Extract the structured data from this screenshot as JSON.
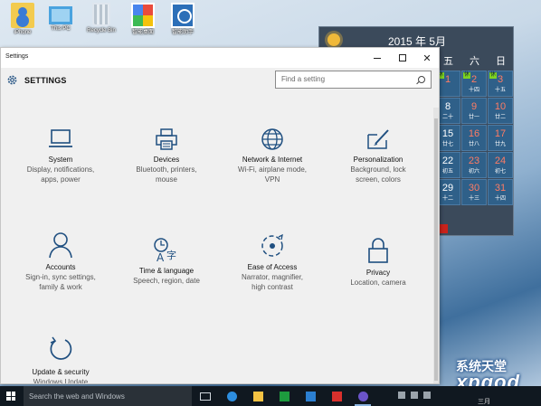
{
  "desktop": {
    "icons": [
      {
        "label": "iPhone",
        "icon": "user-folder-icon"
      },
      {
        "label": "This PC",
        "icon": "computer-icon"
      },
      {
        "label": "Recycle Bin",
        "icon": "recycle-bin-icon"
      },
      {
        "label": "智能桌面",
        "icon": "app-shortcut-icon"
      },
      {
        "label": "智能助手",
        "icon": "app-shortcut-icon"
      }
    ]
  },
  "calendar": {
    "month_label": "2015 年 5月",
    "weekdays": [
      "五",
      "六",
      "日"
    ],
    "rows": [
      [
        {
          "d": "1",
          "l": "",
          "badge": "休",
          "red": true
        },
        {
          "d": "2",
          "l": "十四",
          "badge": "休",
          "red": true
        },
        {
          "d": "3",
          "l": "十五",
          "badge": "休",
          "red": true
        }
      ],
      [
        {
          "d": "8",
          "l": "二十",
          "red": false
        },
        {
          "d": "9",
          "l": "廿一",
          "red": true
        },
        {
          "d": "10",
          "l": "廿二",
          "red": true
        }
      ],
      [
        {
          "d": "15",
          "l": "廿七",
          "red": false
        },
        {
          "d": "16",
          "l": "廿八",
          "red": true
        },
        {
          "d": "17",
          "l": "廿九",
          "red": true
        }
      ],
      [
        {
          "d": "22",
          "l": "初五",
          "red": false
        },
        {
          "d": "23",
          "l": "初六",
          "red": true
        },
        {
          "d": "24",
          "l": "初七",
          "red": true
        }
      ],
      [
        {
          "d": "29",
          "l": "十二",
          "red": false
        },
        {
          "d": "30",
          "l": "十三",
          "red": true
        },
        {
          "d": "31",
          "l": "十四",
          "red": true
        }
      ]
    ]
  },
  "window": {
    "title": "Settings",
    "heading": "SETTINGS",
    "search_placeholder": "Find a setting",
    "tiles": [
      {
        "name": "System",
        "desc1": "Display, notifications,",
        "desc2": "apps, power",
        "icon": "laptop-icon"
      },
      {
        "name": "Devices",
        "desc1": "Bluetooth, printers,",
        "desc2": "mouse",
        "icon": "printer-icon"
      },
      {
        "name": "Network & Internet",
        "desc1": "Wi-Fi, airplane mode,",
        "desc2": "VPN",
        "icon": "globe-icon"
      },
      {
        "name": "Personalization",
        "desc1": "Background, lock",
        "desc2": "screen, colors",
        "icon": "paint-brush-icon"
      },
      {
        "name": "Accounts",
        "desc1": "Sign-in, sync settings,",
        "desc2": "family & work",
        "icon": "person-icon"
      },
      {
        "name": "Time & language",
        "desc1": "Speech, region, date",
        "desc2": "",
        "icon": "time-language-icon"
      },
      {
        "name": "Ease of Access",
        "desc1": "Narrator, magnifier,",
        "desc2": "high contrast",
        "icon": "ease-of-access-icon"
      },
      {
        "name": "Privacy",
        "desc1": "Location, camera",
        "desc2": "",
        "icon": "lock-icon"
      },
      {
        "name": "Update & security",
        "desc1": "Windows Update",
        "desc2": "",
        "icon": "refresh-icon"
      }
    ]
  },
  "taskbar": {
    "search_placeholder": "Search the web and Windows",
    "apps": [
      "task-view-icon",
      "edge-icon",
      "file-explorer-icon",
      "store-icon",
      "app-icon",
      "app-red-icon",
      "settings-app-icon"
    ],
    "clock_text": "三月"
  },
  "watermark": {
    "line1": "系统天堂",
    "line2": "xpgod"
  },
  "colors": {
    "accent": "#2a6aa8",
    "icon_stroke": "#1f4f80",
    "taskbar": "#101820"
  }
}
